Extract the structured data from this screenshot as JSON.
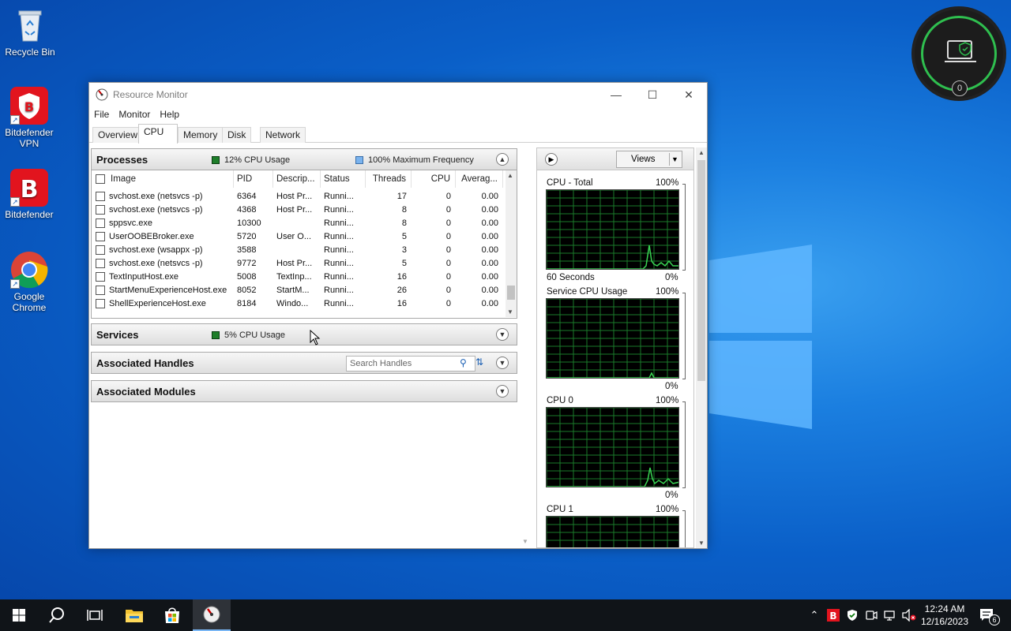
{
  "desktop": {
    "icons": [
      {
        "label": "Recycle Bin"
      },
      {
        "label": "Bitdefender VPN"
      },
      {
        "label": "Bitdefender"
      },
      {
        "label": "Google Chrome"
      }
    ],
    "widget_count": "0"
  },
  "window": {
    "title": "Resource Monitor",
    "menu": [
      "File",
      "Monitor",
      "Help"
    ],
    "tabs": [
      "Overview",
      "CPU",
      "Memory",
      "Disk",
      "Network"
    ],
    "active_tab": "CPU"
  },
  "processes": {
    "title": "Processes",
    "cpu_usage": "12% CPU Usage",
    "max_frequency": "100% Maximum Frequency",
    "columns": [
      "Image",
      "PID",
      "Descrip...",
      "Status",
      "Threads",
      "CPU",
      "Averag..."
    ],
    "rows": [
      [
        "svchost.exe (netsvcs -p)",
        "6364",
        "Host Pr...",
        "Runni...",
        "17",
        "0",
        "0.00"
      ],
      [
        "svchost.exe (netsvcs -p)",
        "4368",
        "Host Pr...",
        "Runni...",
        "8",
        "0",
        "0.00"
      ],
      [
        "sppsvc.exe",
        "10300",
        "",
        "Runni...",
        "8",
        "0",
        "0.00"
      ],
      [
        "UserOOBEBroker.exe",
        "5720",
        "User O...",
        "Runni...",
        "5",
        "0",
        "0.00"
      ],
      [
        "svchost.exe (wsappx -p)",
        "3588",
        "",
        "Runni...",
        "3",
        "0",
        "0.00"
      ],
      [
        "svchost.exe (netsvcs -p)",
        "9772",
        "Host Pr...",
        "Runni...",
        "5",
        "0",
        "0.00"
      ],
      [
        "TextInputHost.exe",
        "5008",
        "TextInp...",
        "Runni...",
        "16",
        "0",
        "0.00"
      ],
      [
        "StartMenuExperienceHost.exe",
        "8052",
        "StartM...",
        "Runni...",
        "26",
        "0",
        "0.00"
      ],
      [
        "ShellExperienceHost.exe",
        "8184",
        "Windo...",
        "Runni...",
        "16",
        "0",
        "0.00"
      ]
    ]
  },
  "services": {
    "title": "Services",
    "cpu_usage": "5% CPU Usage"
  },
  "handles": {
    "title": "Associated Handles",
    "search_placeholder": "Search Handles"
  },
  "modules": {
    "title": "Associated Modules"
  },
  "right_panel": {
    "views_label": "Views",
    "graphs": [
      {
        "label": "CPU - Total",
        "top": "100%",
        "footer_left": "60 Seconds",
        "footer_right": "0%"
      },
      {
        "label": "Service CPU Usage",
        "top": "100%",
        "footer_right": "0%"
      },
      {
        "label": "CPU 0",
        "top": "100%",
        "footer_right": "0%"
      },
      {
        "label": "CPU 1",
        "top": "100%"
      }
    ]
  },
  "taskbar": {
    "time": "12:24 AM",
    "date": "12/16/2023",
    "notification_count": "6"
  },
  "colors": {
    "cpu_usage_swatch": "#1e9e2e",
    "frequency_swatch": "#7ab3ee",
    "graph_line": "#39d353",
    "graph_grid": "#1a7a2a"
  }
}
